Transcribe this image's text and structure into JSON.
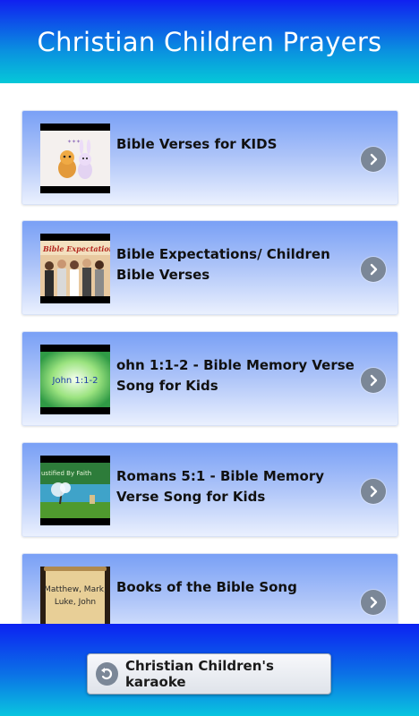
{
  "header": {
    "title": "Christian Children Prayers"
  },
  "items": [
    {
      "title": "Bible Verses for KIDS",
      "icon": "chevron-right-icon"
    },
    {
      "title": "Bible Expectations/ Children Bible Verses",
      "thumb_text": "Bible Expectation",
      "icon": "chevron-right-icon"
    },
    {
      "title": "ohn 1:1-2 - Bible Memory Verse Song for Kids",
      "thumb_text": "John 1:1-2",
      "icon": "chevron-right-icon"
    },
    {
      "title": "Romans 5:1 - Bible Memory Verse Song for Kids",
      "thumb_text": "ustified By Faith",
      "icon": "chevron-right-icon"
    },
    {
      "title": "Books of the Bible Song",
      "thumb_text": "Matthew, Mark, Luke, John",
      "icon": "chevron-right-icon"
    }
  ],
  "footer": {
    "button_label": "Christian Children's karaoke",
    "icon": "back-arrow-icon"
  },
  "colors": {
    "header_top": "#1020f0",
    "header_bottom": "#06c8d8",
    "card_top": "#79a0f6",
    "card_bottom": "#eaf0fe",
    "chevron": "#7b8797"
  }
}
